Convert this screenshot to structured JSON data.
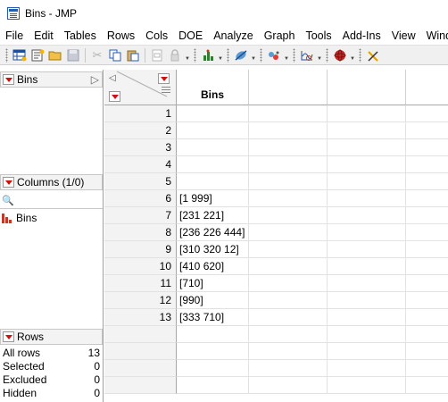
{
  "window": {
    "title": "Bins - JMP"
  },
  "menu": [
    "File",
    "Edit",
    "Tables",
    "Rows",
    "Cols",
    "DOE",
    "Analyze",
    "Graph",
    "Tools",
    "Add-Ins",
    "View",
    "Window"
  ],
  "toolbar": {
    "icons": [
      "new-data-table-icon",
      "new-script-icon",
      "open-icon",
      "save-icon",
      "cut-icon",
      "copy-icon",
      "paste-icon",
      "lock-icon",
      "distribution-icon",
      "fit-model-icon",
      "graph-builder-icon",
      "control-chart-icon",
      "sphere-icon",
      "crosshair-icon"
    ]
  },
  "panels": {
    "table_panel": {
      "label": "Bins"
    },
    "columns_panel": {
      "label": "Columns (1/0)",
      "search_placeholder": "",
      "columns": [
        {
          "name": "Bins",
          "type_icon": "nominal-bar-icon"
        }
      ]
    },
    "rows_panel": {
      "label": "Rows",
      "stats": [
        {
          "label": "All rows",
          "value": "13"
        },
        {
          "label": "Selected",
          "value": "0"
        },
        {
          "label": "Excluded",
          "value": "0"
        },
        {
          "label": "Hidden",
          "value": "0"
        }
      ]
    }
  },
  "grid": {
    "columns": [
      {
        "name": "Bins"
      }
    ],
    "rows": [
      {
        "num": "1",
        "bins": ""
      },
      {
        "num": "2",
        "bins": ""
      },
      {
        "num": "3",
        "bins": ""
      },
      {
        "num": "4",
        "bins": ""
      },
      {
        "num": "5",
        "bins": ""
      },
      {
        "num": "6",
        "bins": "[1 999]"
      },
      {
        "num": "7",
        "bins": "[231 221]"
      },
      {
        "num": "8",
        "bins": "[236 226 444]"
      },
      {
        "num": "9",
        "bins": "[310 320 12]"
      },
      {
        "num": "10",
        "bins": "[410 620]"
      },
      {
        "num": "11",
        "bins": "[710]"
      },
      {
        "num": "12",
        "bins": "[990]"
      },
      {
        "num": "13",
        "bins": "[333 710]"
      },
      {
        "num": "",
        "bins": ""
      },
      {
        "num": "",
        "bins": ""
      },
      {
        "num": "",
        "bins": ""
      },
      {
        "num": "",
        "bins": ""
      }
    ]
  },
  "colors": {
    "red_triangle": "#d01010",
    "nominal_icon": "#c0392b",
    "header_bg": "#f3f3f3"
  }
}
